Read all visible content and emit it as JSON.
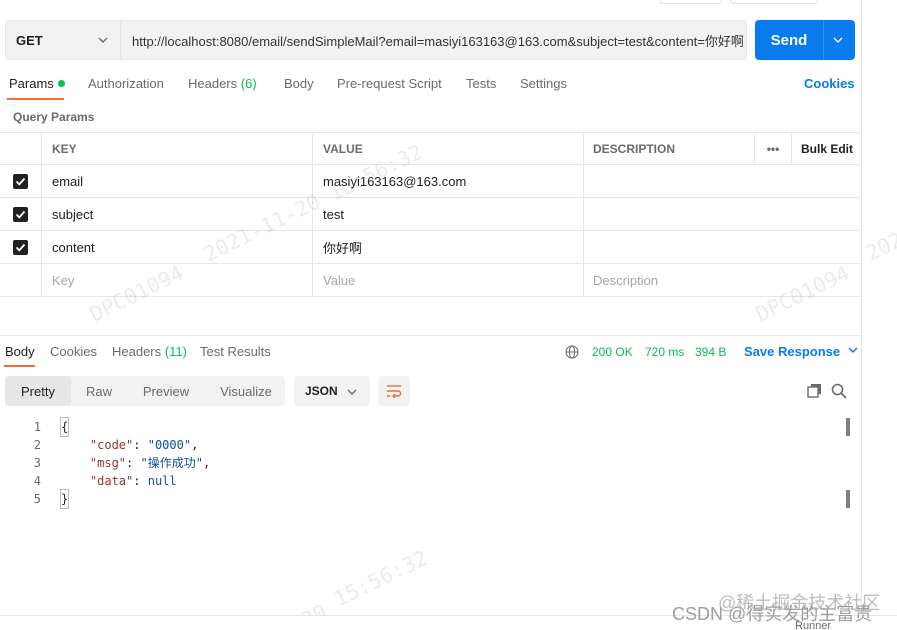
{
  "request": {
    "method": "GET",
    "url": "http://localhost:8080/email/sendSimpleMail?email=masiyi163163@163.com&subject=test&content=你好啊",
    "send_label": "Send"
  },
  "request_tabs": [
    {
      "label": "Params",
      "active": true,
      "indicator": true
    },
    {
      "label": "Authorization"
    },
    {
      "label": "Headers",
      "count": "(6)"
    },
    {
      "label": "Body"
    },
    {
      "label": "Pre-request Script"
    },
    {
      "label": "Tests"
    },
    {
      "label": "Settings"
    }
  ],
  "cookies_label": "Cookies",
  "query_params": {
    "title": "Query Params",
    "headers": {
      "key": "KEY",
      "value": "VALUE",
      "description": "DESCRIPTION",
      "more": "•••",
      "bulk_edit": "Bulk Edit"
    },
    "rows": [
      {
        "key": "email",
        "value": "masiyi163163@163.com",
        "checked": true
      },
      {
        "key": "subject",
        "value": "test",
        "checked": true
      },
      {
        "key": "content",
        "value": "你好啊",
        "checked": true
      }
    ],
    "placeholders": {
      "key": "Key",
      "value": "Value",
      "description": "Description"
    }
  },
  "response_tabs": [
    {
      "label": "Body",
      "active": true
    },
    {
      "label": "Cookies"
    },
    {
      "label": "Headers",
      "count": "(11)"
    },
    {
      "label": "Test Results"
    }
  ],
  "response_status": {
    "status": "200 OK",
    "time": "720 ms",
    "size": "394 B"
  },
  "save_response_label": "Save Response",
  "view_modes": [
    "Pretty",
    "Raw",
    "Preview",
    "Visualize"
  ],
  "format": "JSON",
  "code_lines": {
    "l1": {
      "num": "1",
      "open": "{"
    },
    "l2": {
      "num": "2",
      "key": "\"code\"",
      "sep": ": ",
      "val": "\"0000\"",
      "tail": ","
    },
    "l3": {
      "num": "3",
      "key": "\"msg\"",
      "sep": ": ",
      "val": "\"操作成功\"",
      "tail": ","
    },
    "l4": {
      "num": "4",
      "key": "\"data\"",
      "sep": ": ",
      "val": "null"
    },
    "l5": {
      "num": "5",
      "close": "}"
    }
  },
  "watermark": {
    "code": "DPC01094",
    "timestamp": "2021-11-20  15:56:32",
    "ts_date": "2021-11-20",
    "ts_time": "15:56:32",
    "ts_short": "-11-20",
    "ts_edge": "202"
  },
  "bottom_watermark": {
    "csdn": "CSDN @得实发的主富贵",
    "juejin": "@稀土掘金技术社区",
    "runner": "Runner"
  },
  "colors": {
    "accent": "#097bed",
    "tab_active": "#f26b3a",
    "success": "#0cbb52"
  }
}
